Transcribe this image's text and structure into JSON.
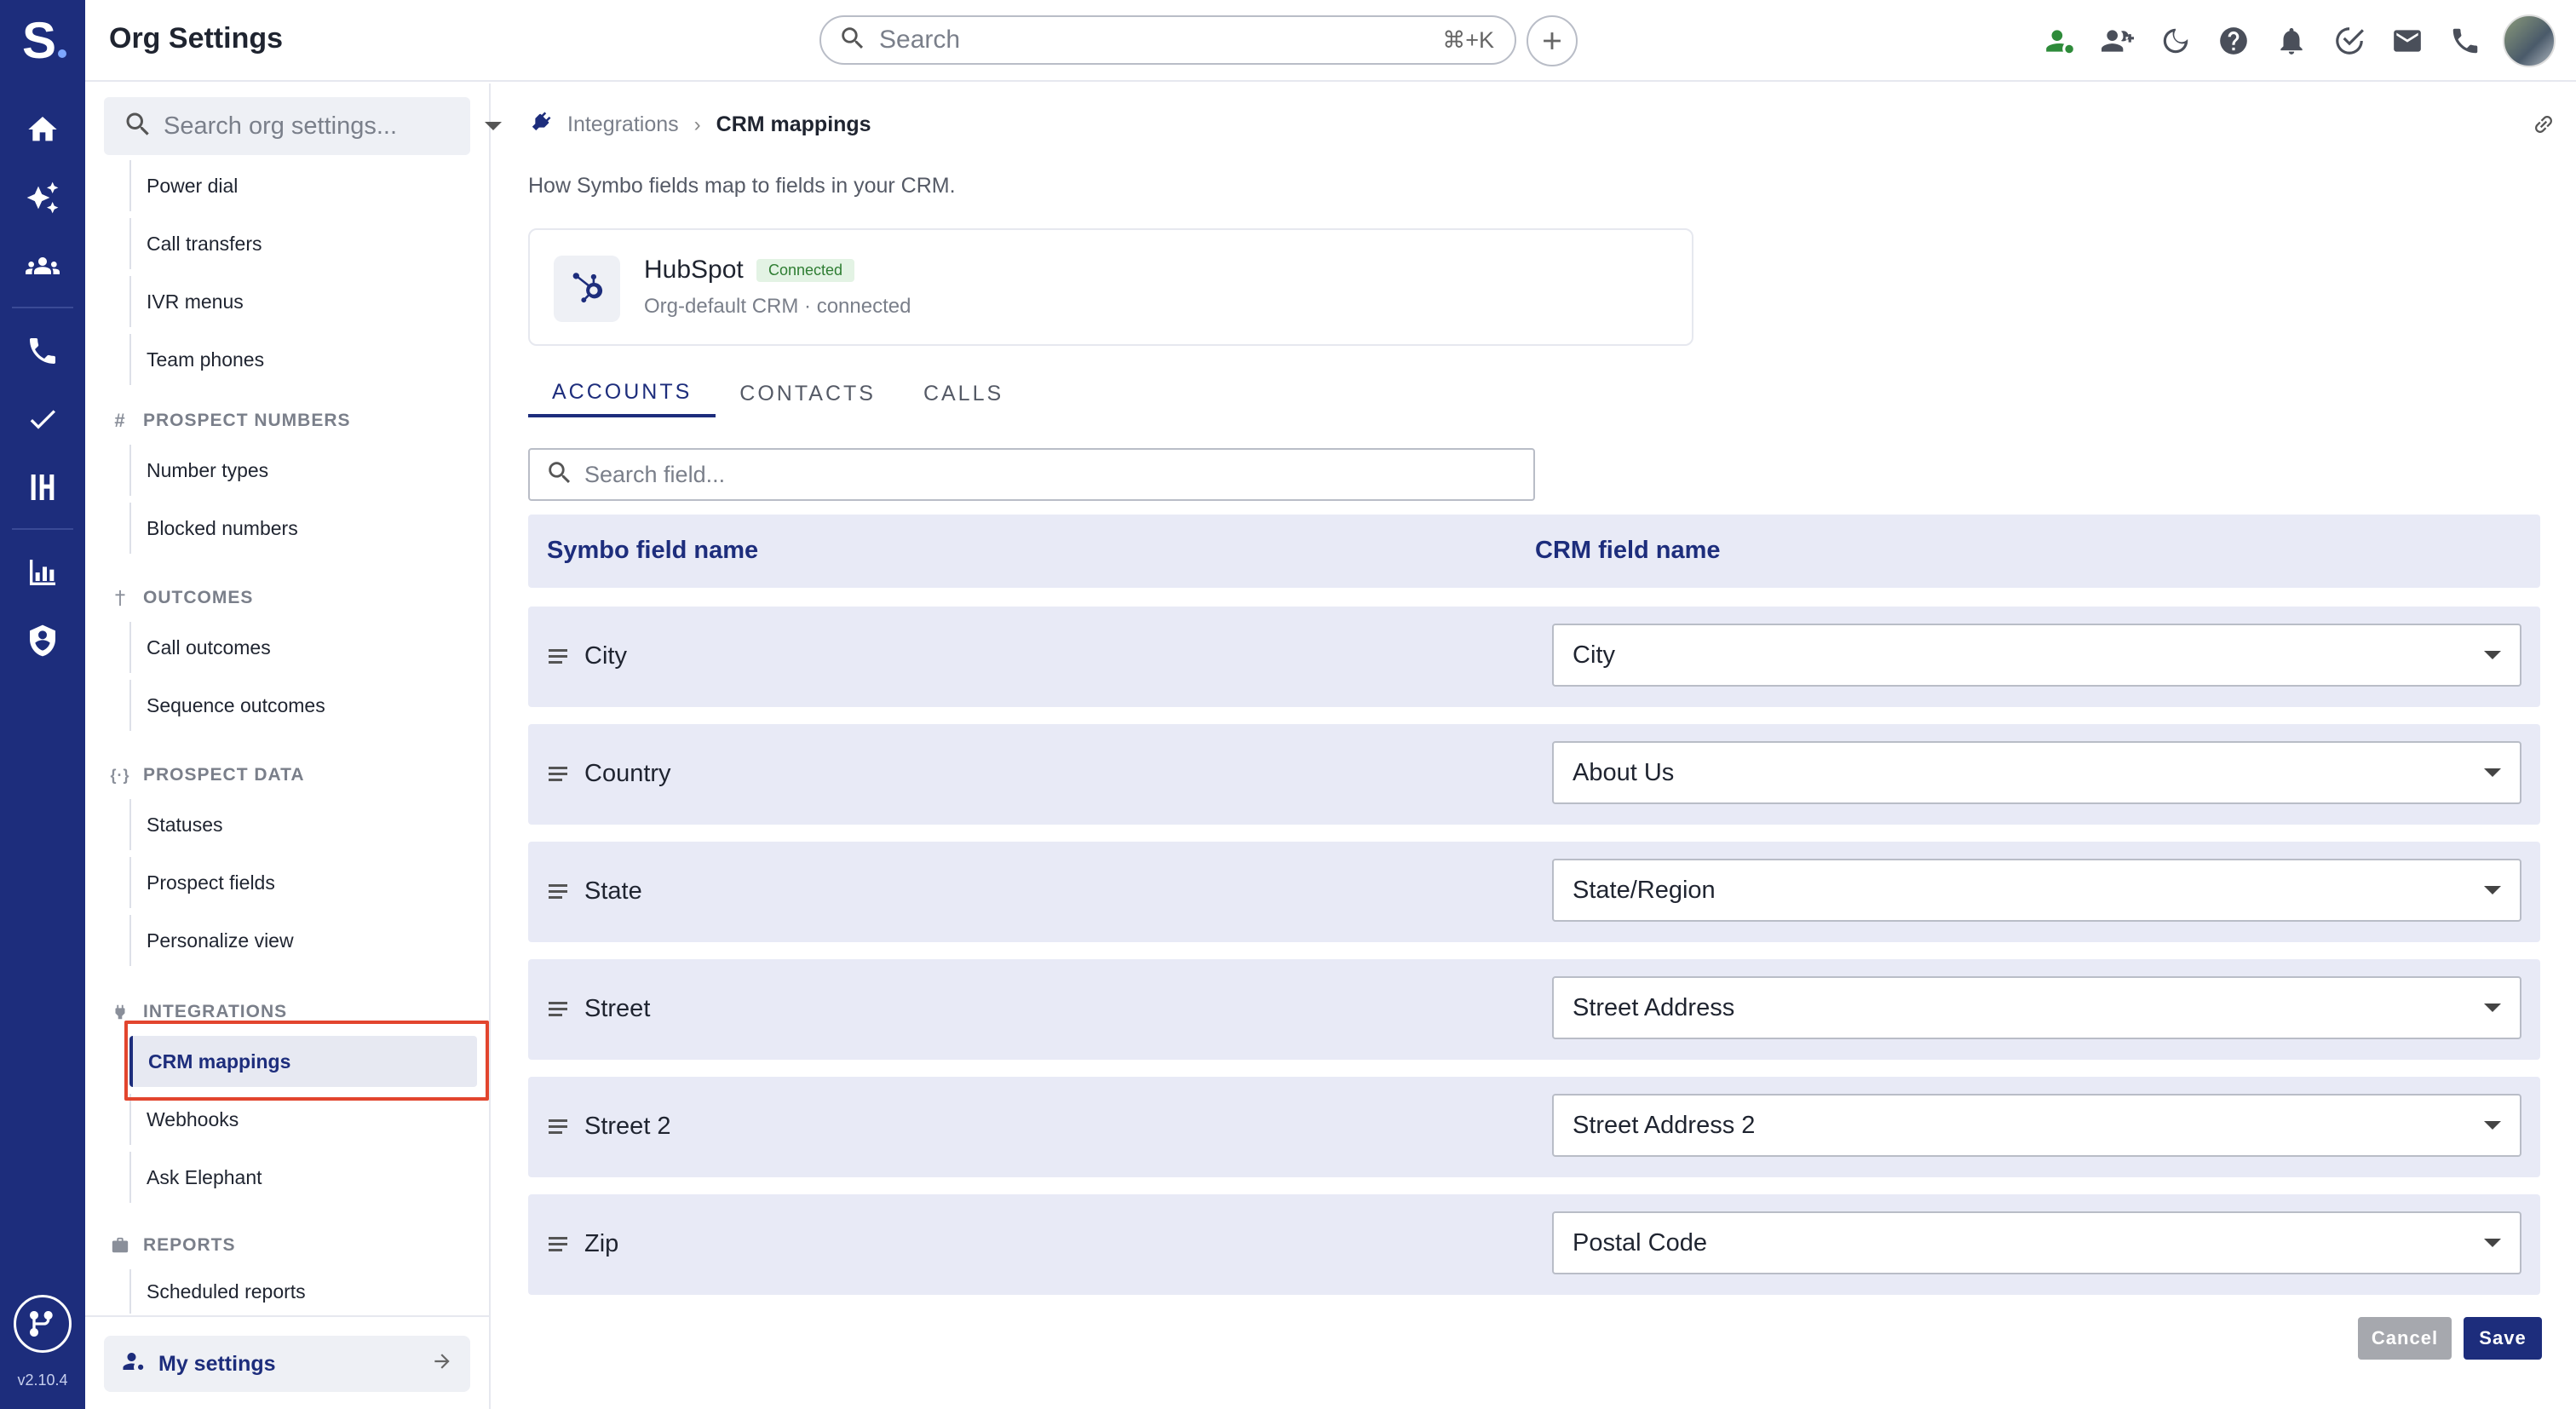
{
  "app": {
    "title": "Org Settings",
    "version": "v2.10.4"
  },
  "search": {
    "placeholder": "Search",
    "shortcut": "⌘+K"
  },
  "sidebar": {
    "search_placeholder": "Search org settings...",
    "items_top": [
      {
        "label": "Power dial"
      },
      {
        "label": "Call transfers"
      },
      {
        "label": "IVR menus"
      },
      {
        "label": "Team phones"
      }
    ],
    "sections": [
      {
        "title": "PROSPECT NUMBERS",
        "items": [
          "Number types",
          "Blocked numbers"
        ]
      },
      {
        "title": "OUTCOMES",
        "items": [
          "Call outcomes",
          "Sequence outcomes"
        ]
      },
      {
        "title": "PROSPECT DATA",
        "items": [
          "Statuses",
          "Prospect fields",
          "Personalize view"
        ]
      },
      {
        "title": "INTEGRATIONS",
        "items": [
          "CRM mappings",
          "Webhooks",
          "Ask Elephant"
        ]
      },
      {
        "title": "REPORTS",
        "items": [
          "Scheduled reports"
        ]
      }
    ],
    "my_settings": "My settings"
  },
  "breadcrumb": {
    "parent": "Integrations",
    "current": "CRM mappings"
  },
  "subtitle": "How Symbo fields map to fields in your CRM.",
  "crm": {
    "name": "HubSpot",
    "status": "Connected",
    "description": "Org-default CRM · connected"
  },
  "tabs": [
    "ACCOUNTS",
    "CONTACTS",
    "CALLS"
  ],
  "field_search_placeholder": "Search field...",
  "table": {
    "col_symbo": "Symbo field name",
    "col_crm": "CRM field name",
    "rows": [
      {
        "symbo": "City",
        "crm": "City"
      },
      {
        "symbo": "Country",
        "crm": "About Us"
      },
      {
        "symbo": "State",
        "crm": "State/Region"
      },
      {
        "symbo": "Street",
        "crm": "Street Address"
      },
      {
        "symbo": "Street 2",
        "crm": "Street Address 2"
      },
      {
        "symbo": "Zip",
        "crm": "Postal Code"
      }
    ]
  },
  "buttons": {
    "cancel": "Cancel",
    "save": "Save"
  },
  "colors": {
    "brand": "#1d2d7c",
    "highlight": "#e2452e",
    "connected": "#2e7d32"
  }
}
